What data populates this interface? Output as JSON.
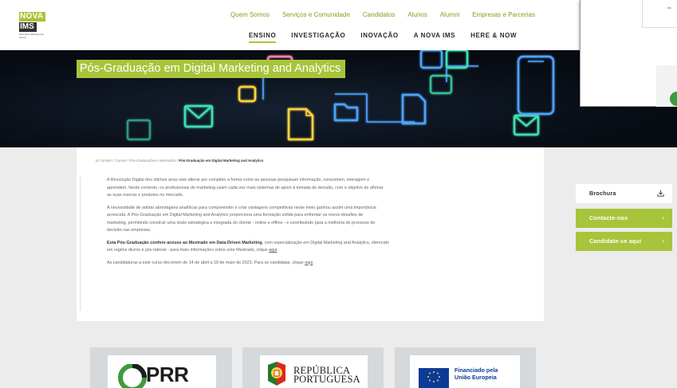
{
  "logo": {
    "nova": "NOVA",
    "ims": "IMS",
    "subtitle": "Information Management School"
  },
  "topnav": [
    "Quem Somos",
    "Serviços e Comunidade",
    "Candidatos",
    "Alunos",
    "Alumni",
    "Empresas e Parcerias"
  ],
  "mainnav": {
    "items": [
      "ENSINO",
      "INVESTIGAÇÃO",
      "INOVAÇÃO",
      "A NOVA IMS",
      "HERE & NOW"
    ],
    "active": "ENSINO"
  },
  "hero": {
    "title": "Pós-Graduação em Digital Marketing and Analytics"
  },
  "overlay": {
    "snippet": "As"
  },
  "breadcrumb": {
    "items": [
      "pt",
      "Ensino",
      "Cursos",
      "Pós-Graduações e Mestrados"
    ],
    "separator": "/",
    "current": "Pós-Graduação em Digital Marketing and Analytics"
  },
  "content": {
    "p1_line1": "A Revolução Digital dos últimos anos veio alterar por completo a forma como as pessoas pesquisam informação, consomem, interagem e",
    "p1_line2": "aprendem. Neste contexto, os profissionais de marketing usam cada vez mais sistemas de apoio à tomada de decisão, com o objetivo de afirmar",
    "p1_line3": "as suas marcas e produtos no mercado.",
    "p2_line1": "A necessidade de adotar abordagens analíticas para compreender e criar vantagens competitivas neste meio ganhou assim uma importância",
    "p2_line2": "acrescida. A Pós-Graduação em Digital Marketing and Analytics proporciona uma formação sólida para enfrentar os novos desafios de",
    "p2_line3": "marketing, permitindo construir uma visão estratégica e integrada do cliente - online e offline - e contribuindo para a melhoria do processo de",
    "p2_line4": "decisão nas empresas.",
    "p3_bold": "Esta Pós-Graduação confere acesso ao Mestrado em Data-Driven Marketing",
    "p3_rest": ", com especialização em Digital Marketing and Analytics, oferecido",
    "p3_line2": "em regime diurno e pós-laboral - para mais informações sobre este Mestrado, clique ",
    "p3_link": "aqui",
    "p3_end": ".",
    "p4_text": "As candidaturas a este curso decorrem de 14 de abril a 18 de maio de 2023. Para se candidatar, clique ",
    "p4_link": "aqui",
    "p4_end": "."
  },
  "sidebar": {
    "brochura": "Brochura",
    "brochura_icon": "download-icon",
    "contact": "Contacte-nos",
    "apply": "Candidate-se aqui",
    "arrow": "›"
  },
  "funding": {
    "prr": "PRR",
    "republica_line1": "REPÚBLICA",
    "republica_line2": "PORTUGUESA",
    "eu_line1": "Financiado pela",
    "eu_line2": "União Europeia"
  },
  "colors": {
    "brand_green": "#a8c43a",
    "eu_blue": "#0b3b99",
    "hero_dark": "#070b12"
  }
}
